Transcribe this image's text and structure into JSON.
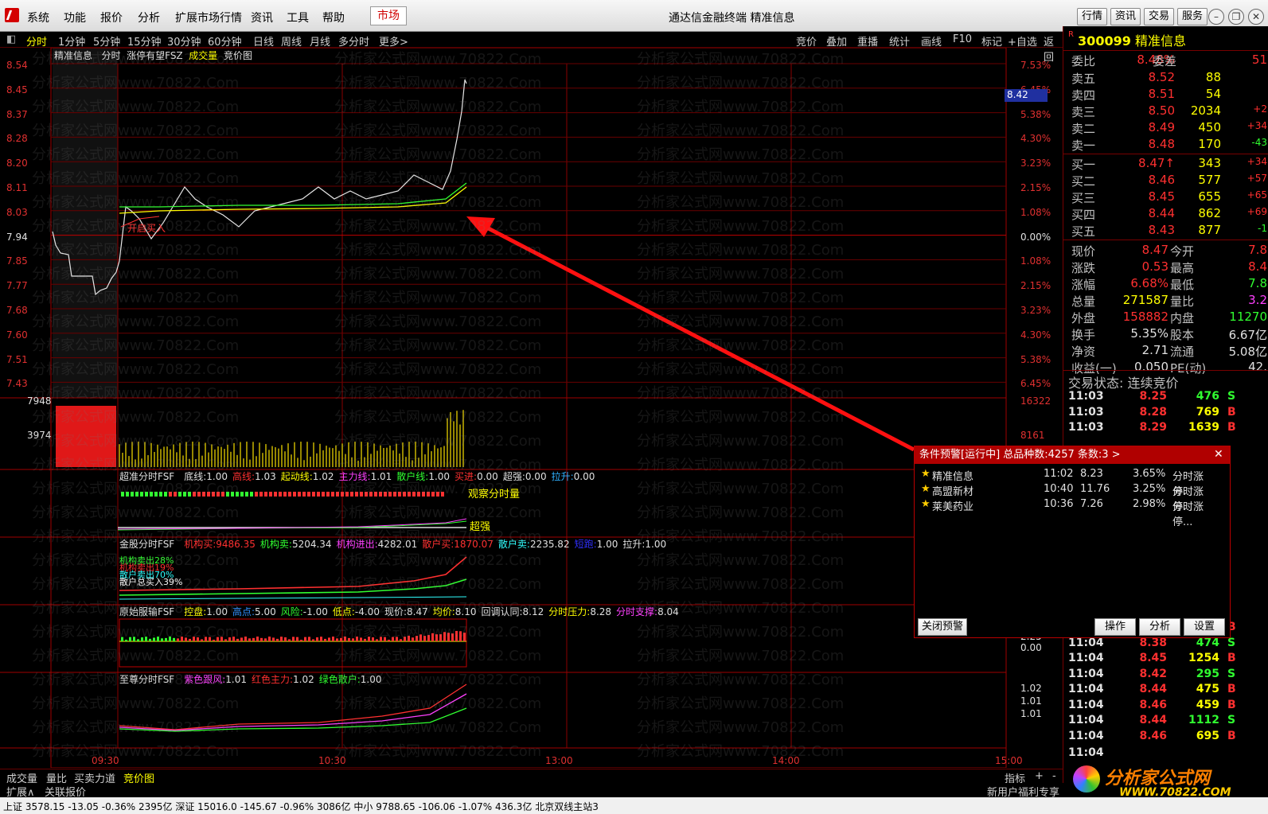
{
  "menu": [
    "系统",
    "功能",
    "报价",
    "分析",
    "扩展市场行情",
    "资讯",
    "工具",
    "帮助"
  ],
  "market_tab": "市场",
  "window_title": "通达信金融终端 精准信息",
  "top_buttons": [
    "行情",
    "资讯",
    "交易",
    "服务"
  ],
  "periods": [
    "分时",
    "1分钟",
    "5分钟",
    "15分钟",
    "30分钟",
    "60分钟",
    "日线",
    "周线",
    "月线",
    "多分时",
    "更多>"
  ],
  "right_tools": [
    "竞价",
    "叠加",
    "重播",
    "统计",
    "画线",
    "F10",
    "标记",
    "+自选",
    "返回"
  ],
  "chart_title": {
    "name": "精准信息",
    "mode": "分时",
    "indicator": "涨停有望FSZ",
    "vol": "成交量",
    "auction": "竞价图"
  },
  "price_axis": [
    "8.54",
    "8.45",
    "8.37",
    "8.28",
    "8.20",
    "8.11",
    "8.03",
    "7.94",
    "7.85",
    "7.77",
    "7.68",
    "7.60",
    "7.51",
    "7.43"
  ],
  "pct_axis": [
    "7.53%",
    "6.45%",
    "5.38%",
    "4.30%",
    "3.23%",
    "2.15%",
    "1.08%",
    "0.00%",
    "1.08%",
    "2.15%",
    "3.23%",
    "4.30%",
    "5.38%",
    "6.45%"
  ],
  "current_price_tag": "8.42",
  "vol_axis_left": [
    "7948",
    "3974"
  ],
  "vol_axis_right": [
    "16322",
    "8161"
  ],
  "time_axis": [
    "09:30",
    "10:30",
    "13:00",
    "14:00",
    "15:00"
  ],
  "sig_buy": "开启买入",
  "ind1": {
    "name": "超准分时FSF",
    "items": [
      {
        "k": "底线:",
        "v": "1.00",
        "c": "#e0e0e0"
      },
      {
        "k": "高线:",
        "v": "1.03",
        "c": "#ff3030"
      },
      {
        "k": "起动线:",
        "v": "1.02",
        "c": "#ffff00"
      },
      {
        "k": "主力线:",
        "v": "1.01",
        "c": "#ff40ff"
      },
      {
        "k": "散户线:",
        "v": "1.00",
        "c": "#30ff30"
      },
      {
        "k": "买进:",
        "v": "0.00",
        "c": "#ff3030"
      },
      {
        "k": "超强:",
        "v": "0.00",
        "c": "#e0e0e0"
      },
      {
        "k": "拉升:",
        "v": "0.00",
        "c": "#30b0ff"
      }
    ],
    "tag1": "观察分时量",
    "tag2": "超强"
  },
  "ind2": {
    "name": "金股分时FSF",
    "items": [
      {
        "k": "机构买:",
        "v": "9486.35",
        "c": "#ff3030"
      },
      {
        "k": "机构卖:",
        "v": "5204.34",
        "c": "#30ff30"
      },
      {
        "k": "机构进出:",
        "v": "4282.01",
        "c": "#ff40ff"
      },
      {
        "k": "散户买:",
        "v": "1870.07",
        "c": "#ff3030"
      },
      {
        "k": "散户卖:",
        "v": "2235.82",
        "c": "#30ffff"
      },
      {
        "k": "短跑:",
        "v": "1.00",
        "c": "#3030ff"
      },
      {
        "k": "拉升:",
        "v": "1.00",
        "c": "#e0e0e0"
      }
    ],
    "notes": [
      "机构卖出28%",
      "机构卖出19%",
      "散户卖出70%",
      "散户总买入39%"
    ]
  },
  "ind3": {
    "name": "原始服输FSF",
    "items": [
      {
        "k": "控盘:",
        "v": "1.00",
        "c": "#ffff00"
      },
      {
        "k": "高点:",
        "v": "5.00",
        "c": "#3090ff"
      },
      {
        "k": "风险:",
        "v": "-1.00",
        "c": "#30ff30"
      },
      {
        "k": "低点:",
        "v": "-4.00",
        "c": "#ffff00"
      },
      {
        "k": "现价:",
        "v": "8.47",
        "c": "#e0e0e0"
      },
      {
        "k": "均价:",
        "v": "8.10",
        "c": "#ffff00"
      },
      {
        "k": "回调认同:",
        "v": "8.12",
        "c": "#e0e0e0"
      },
      {
        "k": "分时压力:",
        "v": "8.28",
        "c": "#ffff00"
      },
      {
        "k": "分时支撑:",
        "v": "8.04",
        "c": "#ff40ff"
      }
    ],
    "axis": [
      "2.25",
      "0.00"
    ]
  },
  "ind4": {
    "name": "至尊分时FSF",
    "items": [
      {
        "k": "紫色跟风:",
        "v": "1.01",
        "c": "#ff40ff"
      },
      {
        "k": "红色主力:",
        "v": "1.02",
        "c": "#ff3030"
      },
      {
        "k": "绿色散户:",
        "v": "1.00",
        "c": "#30ff30"
      }
    ],
    "axis": [
      "1.02",
      "1.01",
      "1.01"
    ]
  },
  "quote": {
    "code": "300099",
    "name": "精准信息",
    "weibi_label": "委比",
    "weibi": "8.48%",
    "weicha_label": "委差",
    "weicha": "51",
    "asks": [
      {
        "l": "卖五",
        "p": "8.52",
        "v": "88",
        "c": ""
      },
      {
        "l": "卖四",
        "p": "8.51",
        "v": "54",
        "c": ""
      },
      {
        "l": "卖三",
        "p": "8.50",
        "v": "2034",
        "c": "+2"
      },
      {
        "l": "卖二",
        "p": "8.49",
        "v": "450",
        "c": "+34"
      },
      {
        "l": "卖一",
        "p": "8.48",
        "v": "170",
        "c": "-43"
      }
    ],
    "bids": [
      {
        "l": "买一",
        "p": "8.47↑",
        "v": "343",
        "c": "+34"
      },
      {
        "l": "买二",
        "p": "8.46",
        "v": "577",
        "c": "+57"
      },
      {
        "l": "买三",
        "p": "8.45",
        "v": "655",
        "c": "+65"
      },
      {
        "l": "买四",
        "p": "8.44",
        "v": "862",
        "c": "+69"
      },
      {
        "l": "买五",
        "p": "8.43",
        "v": "877",
        "c": "-1"
      }
    ],
    "info": [
      [
        "现价",
        "8.47",
        "今开",
        "7.8"
      ],
      [
        "涨跌",
        "0.53",
        "最高",
        "8.4"
      ],
      [
        "涨幅",
        "6.68%",
        "最低",
        "7.8"
      ],
      [
        "总量",
        "271587",
        "量比",
        "3.2"
      ],
      [
        "外盘",
        "158882",
        "内盘",
        "11270"
      ],
      [
        "换手",
        "5.35%",
        "股本",
        "6.67亿"
      ],
      [
        "净资",
        "2.71",
        "流通",
        "5.08亿"
      ],
      [
        "收益(一)",
        "0.050",
        "PE(动)",
        "42."
      ]
    ],
    "trade_state": "交易状态: 连续竞价"
  },
  "ticks": [
    [
      "11:03",
      "8.25",
      "476",
      "S"
    ],
    [
      "11:03",
      "8.28",
      "769",
      "B"
    ],
    [
      "11:03",
      "8.29",
      "1639",
      "B"
    ],
    [
      "11:04",
      "8.38",
      "1030",
      "B"
    ],
    [
      "11:04",
      "8.38",
      "474",
      "S"
    ],
    [
      "11:04",
      "8.45",
      "1254",
      "B"
    ],
    [
      "11:04",
      "8.42",
      "295",
      "S"
    ],
    [
      "11:04",
      "8.44",
      "475",
      "B"
    ],
    [
      "11:04",
      "8.46",
      "459",
      "B"
    ],
    [
      "11:04",
      "8.44",
      "1112",
      "S"
    ],
    [
      "11:04",
      "8.46",
      "695",
      "B"
    ],
    [
      "11:04",
      "",
      "",
      ""
    ]
  ],
  "popup": {
    "title": "条件预警[运行中] 总品种数:4257 条数:3  >",
    "rows": [
      [
        "精准信息",
        "11:02",
        "8.23",
        "3.65%",
        "分时涨停..."
      ],
      [
        "高盟新材",
        "10:40",
        "11.76",
        "3.25%",
        "分时涨停..."
      ],
      [
        "莱美药业",
        "10:36",
        "7.26",
        "2.98%",
        "分时涨停..."
      ]
    ],
    "close_btn": "关闭预警",
    "btns": [
      "操作",
      "分析",
      "设置"
    ]
  },
  "bottom_tabs": [
    "成交量",
    "量比",
    "买卖力道",
    "竞价图"
  ],
  "bottom_right": [
    "指标",
    "+",
    "-"
  ],
  "bottom2": [
    "扩展∧",
    "关联报价"
  ],
  "welfare": "新用户福利专享",
  "status": "上证 3578.15  -13.05  -0.36%  2395亿   深证 15016.0  -145.67  -0.96%  3086亿   中小 9788.65  -106.06  -1.07%  436.3亿          北京双线主站3",
  "brand": {
    "cn": "分析家公式网",
    "url": "WWW.70822.COM"
  },
  "watermark": "分析家公式网www.70822.Com"
}
